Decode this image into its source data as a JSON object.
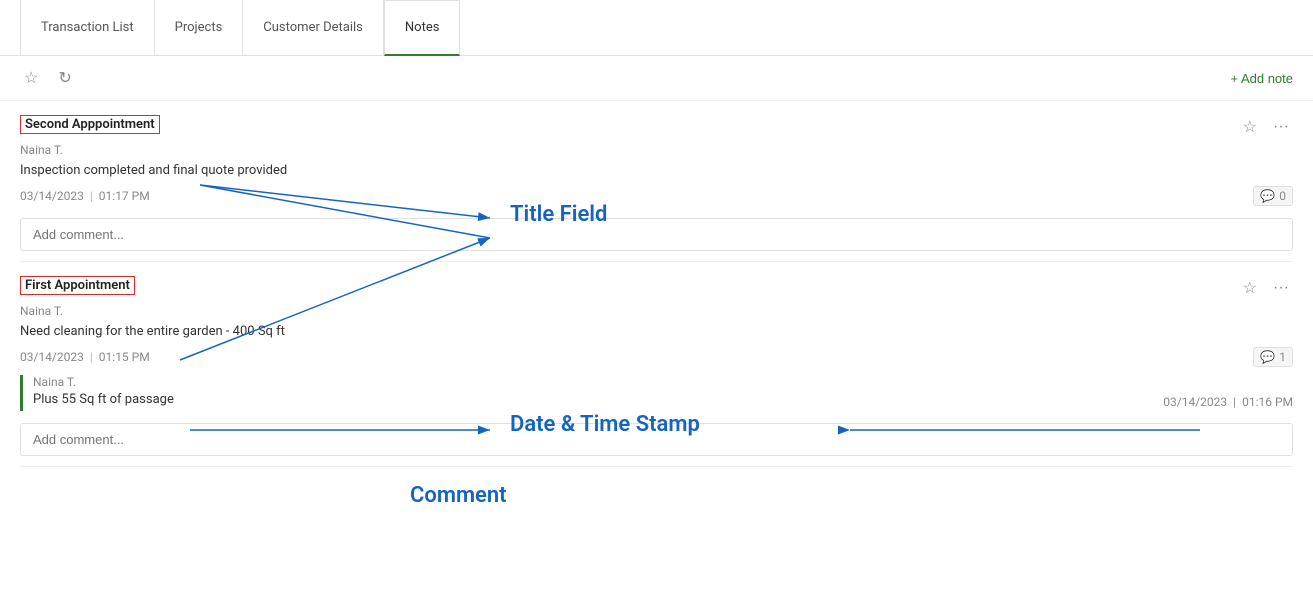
{
  "tabs": [
    {
      "id": "transaction-list",
      "label": "Transaction List",
      "active": false
    },
    {
      "id": "projects",
      "label": "Projects",
      "active": false
    },
    {
      "id": "customer-details",
      "label": "Customer Details",
      "active": false
    },
    {
      "id": "notes",
      "label": "Notes",
      "active": true
    }
  ],
  "toolbar": {
    "add_note_label": "+ Add note"
  },
  "notes": [
    {
      "id": "note-1",
      "title": "Second Apppointment",
      "author": "Naina T.",
      "body": "Inspection completed and final quote provided",
      "date": "03/14/2023",
      "time": "01:17 PM",
      "comment_count": "0",
      "comments": [],
      "add_comment_placeholder": "Add comment..."
    },
    {
      "id": "note-2",
      "title": "First Appointment",
      "author": "Naina T.",
      "body": "Need cleaning for the entire garden - 400 Sq ft",
      "date": "03/14/2023",
      "time": "01:15 PM",
      "comment_count": "1",
      "comments": [
        {
          "author": "Naina T.",
          "body": "Plus 55 Sq ft of passage",
          "date": "03/14/2023",
          "time": "01:16 PM"
        }
      ],
      "add_comment_placeholder": "Add comment..."
    }
  ],
  "annotations": {
    "title_field_label": "Title Field",
    "date_time_stamp_label": "Date & Time Stamp",
    "comment_label": "Comment"
  }
}
